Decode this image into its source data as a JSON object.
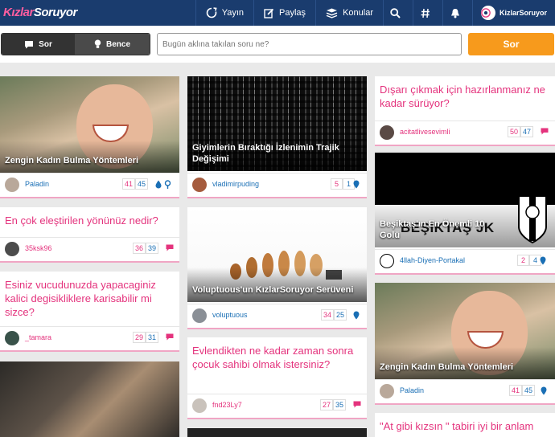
{
  "header": {
    "logo_part1": "Kızlar",
    "logo_part2": "Soruyor",
    "nav": {
      "yayin": "Yayın",
      "paylas": "Paylaş",
      "konular": "Konular"
    },
    "profile_name": "KizlarSoruyor"
  },
  "actionbar": {
    "toggle_sor": "Sor",
    "toggle_bence": "Bence",
    "search_placeholder": "Bugün aklına takılan soru ne?",
    "submit_label": "Sor"
  },
  "cards": [
    {
      "title": "Zengin Kadın Bulma Yöntemleri",
      "user": "Paladin",
      "c1": "41",
      "c2": "45"
    },
    {
      "title": "En çok eleştirilen yönünüz nedir?",
      "user": "35ksk96",
      "c1": "36",
      "c2": "39"
    },
    {
      "title": "Esiniz vucudunuzda yapacaginiz kalici degisikliklere karisabilir mi sizce?",
      "user": "_tamara",
      "c1": "29",
      "c2": "31"
    },
    {
      "title": "Giyimlerin Bıraktığı İzlenimin Trajik Değişimi",
      "user": "vladimirpuding",
      "c1": "5",
      "c2": "1"
    },
    {
      "title": "Voluptuous'un KızlarSoruyor Serüveni",
      "user": "voluptuous",
      "c1": "34",
      "c2": "25"
    },
    {
      "title": "Evlendikten ne kadar zaman sonra çocuk sahibi olmak istersiniz?",
      "user": "fnd23Ly7",
      "c1": "27",
      "c2": "35"
    },
    {
      "title": "Dışarı çıkmak için hazırlanmanız ne kadar sürüyor?",
      "user": "acitatlivesevimli",
      "c1": "50",
      "c2": "47"
    },
    {
      "title": "Beşiktaş'ın En Önemli 10 Golü",
      "user": "4llah-Diyen-Portakal",
      "c1": "2",
      "c2": "4",
      "img_text": "BEŞİKTAŞ JK"
    },
    {
      "title": "Zengin Kadın Bulma Yöntemleri",
      "user": "Paladin",
      "c1": "41",
      "c2": "45"
    },
    {
      "title": "\"At gibi kızsın \" tabiri iyi bir anlam"
    }
  ]
}
